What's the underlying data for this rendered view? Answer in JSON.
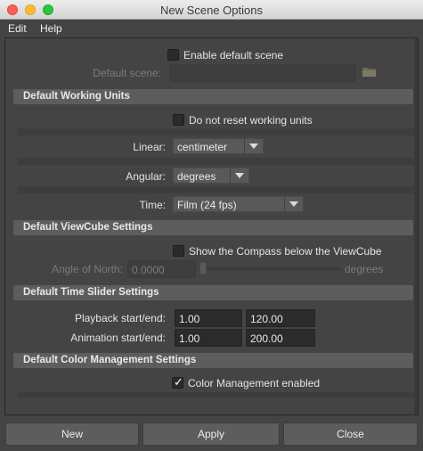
{
  "window": {
    "title": "New Scene Options",
    "controls": [
      "close",
      "minimize",
      "zoom"
    ]
  },
  "menu": {
    "items": [
      {
        "label": "Edit"
      },
      {
        "label": "Help"
      }
    ]
  },
  "top": {
    "enable_default_scene": {
      "label": "Enable default scene",
      "checked": false
    },
    "default_scene": {
      "label": "Default scene:",
      "value": "",
      "icon": "folder-icon"
    }
  },
  "working_units": {
    "header": "Default Working Units",
    "do_not_reset": {
      "label": "Do not reset working units",
      "checked": false
    },
    "linear": {
      "label": "Linear:",
      "value": "centimeter"
    },
    "angular": {
      "label": "Angular:",
      "value": "degrees"
    },
    "time": {
      "label": "Time:",
      "value": "Film (24 fps)"
    }
  },
  "viewcube": {
    "header": "Default ViewCube Settings",
    "show_compass": {
      "label": "Show the Compass below the ViewCube",
      "checked": false
    },
    "angle_of_north": {
      "label": "Angle of North:",
      "value": "0.0000",
      "slider_fraction": 0.0,
      "units": "degrees"
    }
  },
  "time_slider": {
    "header": "Default Time Slider Settings",
    "playback": {
      "label": "Playback start/end:",
      "start": "1.00",
      "end": "120.00"
    },
    "animation": {
      "label": "Animation start/end:",
      "start": "1.00",
      "end": "200.00"
    }
  },
  "color_mgmt": {
    "header": "Default Color Management Settings",
    "enabled": {
      "label": "Color Management enabled",
      "checked": true
    }
  },
  "buttons": {
    "new": "New",
    "apply": "Apply",
    "close": "Close"
  },
  "colors": {
    "background": "#444444",
    "section_header": "#5d5d5d",
    "field": "#2b2b2b"
  }
}
